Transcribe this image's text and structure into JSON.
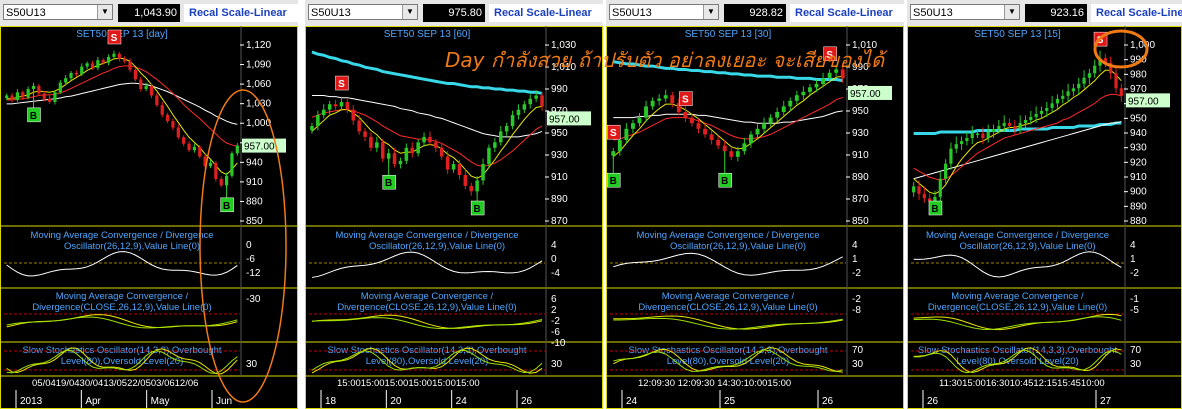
{
  "overlay_text": "Day กำลังสวย ถ้าปรับตัว อย่าลงเยอะ จะเสียของได้",
  "colors": {
    "up": "#28c828",
    "down": "#e02020",
    "ma_red": "#ff2b2b",
    "ma_yellow": "#e8e800",
    "ma_white": "#ffffff",
    "ma_cyan": "#38d8e8",
    "annotation": "#f07a14",
    "buy": "#22cc22",
    "sell": "#e01818"
  },
  "panels": [
    {
      "symbol": "S50U13",
      "price_box": "1,043.90",
      "recal": "Recal Scale-Linear",
      "title": "SET50 SEP 13 [day]",
      "current_label": "957.00",
      "price_ticks": [
        "1,120",
        "1,090",
        "1,060",
        "1,030",
        "1,000",
        "970",
        "940",
        "910",
        "880",
        "850"
      ],
      "macd_label": "Moving Average Convergence / Divergence Oscillator(26,12,9),Value Line(0)",
      "macd_ticks": [
        "0",
        "-6",
        "-12"
      ],
      "macd2_label": "Moving Average Convergence / Divergence(CLOSE,26,12,9),Value Line(0)",
      "macd2_ticks": [
        "-30"
      ],
      "stoch_label": "Slow Stochastics Oscillator(14,3,3),Overbought Level(80),Oversold Level(20)",
      "stoch_ticks": [
        "30"
      ],
      "time_top": "05/0419/0430/0413/0522/0503/0612/06",
      "time_bottom": [
        "2013",
        "Apr",
        "May",
        "Jun"
      ]
    },
    {
      "symbol": "S50U13",
      "price_box": "975.80",
      "recal": "Recal Scale-Linear",
      "title": "SET50 SEP 13  [60]",
      "current_label": "957.00",
      "price_ticks": [
        "1,030",
        "1,010",
        "990",
        "970",
        "950",
        "930",
        "910",
        "890",
        "870"
      ],
      "macd_label": "Moving Average Convergence / Divergence Oscillator(26,12,9),Value Line(0)",
      "macd_ticks": [
        "4",
        "0",
        "-4"
      ],
      "macd2_label": "Moving Average Convergence / Divergence(CLOSE,26,12,9),Value Line(0)",
      "macd2_ticks": [
        "6",
        "2",
        "-2",
        "-6",
        "-10"
      ],
      "stoch_label": "Slow Stochastics Oscillator(14,3,3),Overbought Level(80),Oversold Level(20)",
      "stoch_ticks": [
        "30"
      ],
      "time_top": "15:0015:0015:0015:0015:0015:00",
      "time_bottom": [
        "18",
        "20",
        "24",
        "26"
      ]
    },
    {
      "symbol": "S50U13",
      "price_box": "928.82",
      "recal": "Recal Scale-Linear",
      "title": "SET50 SEP 13  [30]",
      "current_label": "957.00",
      "price_ticks": [
        "1,010",
        "990",
        "970",
        "950",
        "930",
        "910",
        "890",
        "870",
        "850"
      ],
      "macd_label": "Moving Average Convergence / Divergence Oscillator(26,12,9),Value Line(0)",
      "macd_ticks": [
        "4",
        "1",
        "-2"
      ],
      "macd2_label": "Moving Average Convergence / Divergence(CLOSE,26,12,9),Value Line(0)",
      "macd2_ticks": [
        "-2",
        "-8"
      ],
      "stoch_label": "Slow Stochastics Oscillator(14,3,3),Overbought Level(80),Oversold Level(20)",
      "stoch_ticks": [
        "70",
        "30"
      ],
      "time_top": "12:09:30    12:09:30    14:30:10:0015:00",
      "time_bottom": [
        "24",
        "25",
        "26"
      ]
    },
    {
      "symbol": "S50U13",
      "price_box": "923.16",
      "recal": "Recal Scale-Linear",
      "title": "SET50 SEP 13  [15]",
      "current_label": "957.00",
      "price_ticks": [
        "1,000",
        "990",
        "980",
        "970",
        "960",
        "950",
        "940",
        "930",
        "920",
        "910",
        "900",
        "890",
        "880"
      ],
      "macd_label": "Moving Average Convergence / Divergence Oscillator(26,12,9),Value Line(0)",
      "macd_ticks": [
        "4",
        "1",
        "-2"
      ],
      "macd2_label": "Moving Average Convergence / Divergence(CLOSE,26,12,9),Value Line(0)",
      "macd2_ticks": [
        "-1",
        "-5"
      ],
      "stoch_label": "Slow Stochastics Oscillator(14,3,3),Overbought Level(80),Oversold Level(20)",
      "stoch_ticks": [
        "70",
        "30"
      ],
      "time_top": "11:3015:0016:3010:4512:1515:4510:00",
      "time_bottom": [
        "26",
        "27"
      ]
    }
  ],
  "chart_data": [
    {
      "type": "candlestick",
      "title": "SET50 SEP 13 [day]",
      "symbol": "S50U13",
      "y_range": [
        835,
        1140
      ],
      "last": 957.0,
      "closes": [
        1035,
        1028,
        1040,
        1032,
        1045,
        1050,
        1038,
        1030,
        1025,
        1040,
        1055,
        1062,
        1070,
        1068,
        1080,
        1085,
        1078,
        1090,
        1086,
        1095,
        1100,
        1092,
        1088,
        1075,
        1060,
        1045,
        1050,
        1035,
        1020,
        1005,
        995,
        985,
        970,
        960,
        950,
        955,
        940,
        925,
        930,
        905,
        895,
        910,
        945,
        957
      ],
      "ma_fast": [
        1030,
        1030,
        1032,
        1034,
        1036,
        1040,
        1042,
        1041,
        1040,
        1042,
        1046,
        1052,
        1058,
        1063,
        1068,
        1074,
        1078,
        1082,
        1085,
        1088,
        1092,
        1093,
        1092,
        1088,
        1080,
        1070,
        1062,
        1052,
        1042,
        1030,
        1018,
        1005,
        993,
        981,
        970,
        962,
        954,
        944,
        936,
        926,
        916,
        912,
        920,
        930
      ],
      "ma_mid": [
        1028,
        1028,
        1029,
        1030,
        1031,
        1033,
        1035,
        1036,
        1036,
        1037,
        1039,
        1042,
        1046,
        1050,
        1054,
        1058,
        1062,
        1066,
        1070,
        1073,
        1077,
        1080,
        1081,
        1081,
        1079,
        1076,
        1072,
        1066,
        1060,
        1053,
        1046,
        1038,
        1030,
        1021,
        1013,
        1006,
        999,
        991,
        983,
        975,
        967,
        961,
        958,
        956
      ],
      "ma_slow": [
        1022,
        1022,
        1023,
        1024,
        1025,
        1026,
        1027,
        1028,
        1029,
        1030,
        1031,
        1033,
        1034,
        1036,
        1038,
        1040,
        1042,
        1044,
        1046,
        1048,
        1050,
        1052,
        1053,
        1054,
        1054,
        1053,
        1052,
        1050,
        1047,
        1044,
        1041,
        1037,
        1033,
        1029,
        1025,
        1021,
        1017,
        1012,
        1008,
        1003,
        999,
        995,
        992,
        990
      ],
      "signals": [
        {
          "type": "B",
          "i": 5
        },
        {
          "type": "S",
          "i": 20
        },
        {
          "type": "B",
          "i": 41
        }
      ]
    },
    {
      "type": "candlestick",
      "title": "SET50 SEP 13  [60]",
      "symbol": "S50U13",
      "y_range": [
        860,
        1040
      ],
      "last": 957.0,
      "closes": [
        950,
        960,
        965,
        970,
        968,
        972,
        965,
        955,
        945,
        940,
        930,
        935,
        920,
        925,
        915,
        918,
        930,
        925,
        935,
        940,
        935,
        930,
        922,
        910,
        915,
        905,
        895,
        890,
        900,
        915,
        930,
        935,
        945,
        950,
        960,
        965,
        970,
        975,
        978,
        968
      ],
      "ma_fast": [
        945,
        950,
        955,
        960,
        962,
        965,
        965,
        962,
        958,
        952,
        946,
        942,
        936,
        933,
        928,
        925,
        926,
        926,
        929,
        932,
        933,
        932,
        929,
        924,
        921,
        916,
        910,
        904,
        902,
        905,
        912,
        919,
        927,
        934,
        942,
        949,
        956,
        962,
        967,
        968
      ],
      "ma_mid": [
        958,
        960,
        962,
        963,
        964,
        965,
        965,
        964,
        962,
        960,
        957,
        954,
        950,
        947,
        944,
        941,
        940,
        939,
        938,
        938,
        937,
        936,
        934,
        931,
        928,
        925,
        921,
        917,
        914,
        913,
        914,
        916,
        919,
        923,
        927,
        932,
        937,
        942,
        947,
        950
      ],
      "ma_slow": [
        978,
        978,
        978,
        977,
        977,
        976,
        976,
        975,
        974,
        973,
        972,
        971,
        970,
        969,
        968,
        966,
        965,
        964,
        962,
        961,
        960,
        958,
        957,
        955,
        953,
        951,
        949,
        947,
        945,
        943,
        942,
        941,
        940,
        940,
        940,
        940,
        941,
        942,
        943,
        945
      ],
      "ma_long": [
        1018,
        1016,
        1015,
        1013,
        1012,
        1010,
        1009,
        1007,
        1006,
        1004,
        1003,
        1002,
        1000,
        999,
        998,
        997,
        996,
        995,
        994,
        993,
        992,
        991,
        990,
        989,
        989,
        988,
        987,
        986,
        986,
        985,
        985,
        984,
        984,
        983,
        983,
        982,
        982,
        981,
        981,
        980
      ],
      "signals": [
        {
          "type": "S",
          "i": 5
        },
        {
          "type": "B",
          "i": 13
        },
        {
          "type": "B",
          "i": 28
        }
      ]
    },
    {
      "type": "candlestick",
      "title": "SET50 SEP 13  [30]",
      "symbol": "S50U13",
      "y_range": [
        840,
        1015
      ],
      "last": 957.0,
      "closes": [
        905,
        915,
        925,
        930,
        935,
        945,
        950,
        952,
        955,
        948,
        940,
        935,
        930,
        925,
        920,
        915,
        910,
        905,
        900,
        905,
        912,
        920,
        925,
        930,
        935,
        940,
        945,
        950,
        955,
        958,
        962,
        965,
        970,
        975,
        978,
        970
      ],
      "ma_fast": [
        900,
        905,
        912,
        919,
        925,
        932,
        938,
        943,
        947,
        947,
        945,
        942,
        938,
        934,
        929,
        924,
        919,
        914,
        909,
        907,
        908,
        912,
        916,
        921,
        926,
        931,
        936,
        941,
        946,
        950,
        955,
        959,
        963,
        967,
        971,
        972
      ],
      "ma_mid": [
        915,
        916,
        918,
        920,
        922,
        925,
        928,
        931,
        934,
        935,
        935,
        935,
        934,
        932,
        930,
        928,
        925,
        922,
        919,
        917,
        916,
        916,
        917,
        918,
        920,
        923,
        926,
        929,
        932,
        935,
        938,
        941,
        944,
        947,
        951,
        953
      ],
      "ma_slow": [
        935,
        935,
        935,
        935,
        936,
        936,
        937,
        937,
        938,
        938,
        938,
        938,
        938,
        937,
        937,
        936,
        935,
        934,
        933,
        932,
        931,
        931,
        930,
        930,
        930,
        930,
        931,
        931,
        932,
        933,
        934,
        935,
        936,
        938,
        940,
        941
      ],
      "ma_long": [
        985,
        984,
        983,
        983,
        982,
        981,
        981,
        980,
        979,
        979,
        978,
        978,
        977,
        977,
        976,
        976,
        975,
        975,
        974,
        974,
        973,
        973,
        972,
        972,
        972,
        971,
        971,
        971,
        970,
        970,
        970,
        969,
        969,
        969,
        969,
        968
      ],
      "signals": [
        {
          "type": "S",
          "i": 0
        },
        {
          "type": "B",
          "i": 0
        },
        {
          "type": "S",
          "i": 11
        },
        {
          "type": "B",
          "i": 17
        },
        {
          "type": "S",
          "i": 33
        }
      ]
    },
    {
      "type": "candlestick",
      "title": "SET50 SEP 13  [15]",
      "symbol": "S50U13",
      "y_range": [
        875,
        1005
      ],
      "last": 957.0,
      "closes": [
        900,
        895,
        892,
        890,
        893,
        905,
        915,
        925,
        928,
        930,
        932,
        935,
        935,
        932,
        936,
        938,
        940,
        942,
        940,
        938,
        942,
        944,
        946,
        948,
        950,
        952,
        955,
        958,
        960,
        963,
        965,
        968,
        972,
        975,
        980,
        985,
        982,
        975,
        965,
        960
      ],
      "ma_fast": [
        905,
        902,
        899,
        896,
        895,
        897,
        901,
        907,
        913,
        918,
        922,
        926,
        929,
        930,
        932,
        934,
        936,
        938,
        939,
        939,
        940,
        941,
        942,
        944,
        945,
        947,
        949,
        951,
        954,
        956,
        959,
        961,
        964,
        967,
        970,
        974,
        977,
        977,
        974,
        970
      ],
      "ma_mid": [
        912,
        910,
        908,
        906,
        905,
        904,
        905,
        907,
        910,
        913,
        916,
        919,
        922,
        924,
        926,
        928,
        930,
        932,
        933,
        934,
        935,
        936,
        937,
        938,
        939,
        940,
        941,
        942,
        944,
        945,
        947,
        949,
        951,
        953,
        955,
        958,
        960,
        961,
        961,
        960
      ],
      "ma_slow": [
        905,
        906,
        907,
        908,
        909,
        910,
        911,
        912,
        913,
        914,
        915,
        916,
        917,
        918,
        919,
        920,
        921,
        922,
        923,
        924,
        925,
        926,
        927,
        928,
        929,
        930,
        931,
        932,
        933,
        934,
        935,
        936,
        937,
        938,
        939,
        940,
        941,
        942,
        942,
        943
      ],
      "ma_long": [
        935,
        935,
        935,
        935,
        935,
        936,
        936,
        936,
        936,
        936,
        936,
        936,
        937,
        937,
        937,
        937,
        937,
        937,
        937,
        937,
        938,
        938,
        938,
        938,
        938,
        938,
        939,
        939,
        939,
        939,
        939,
        940,
        940,
        940,
        940,
        941,
        941,
        941,
        942,
        942
      ],
      "signals": [
        {
          "type": "B",
          "i": 4
        },
        {
          "type": "S",
          "i": 35
        }
      ]
    }
  ]
}
